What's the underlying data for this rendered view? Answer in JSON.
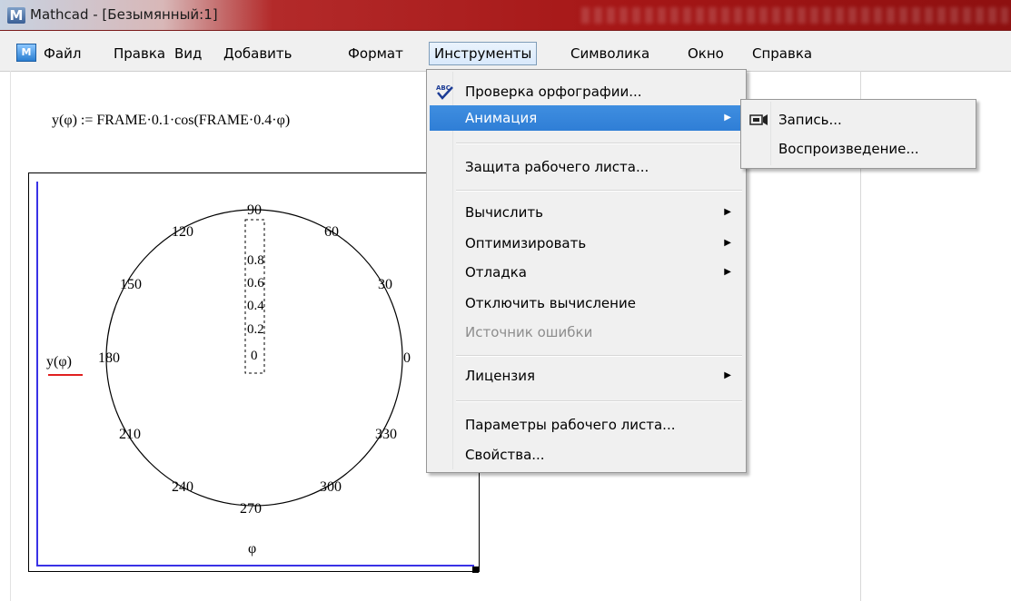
{
  "window": {
    "app_name": "Mathcad - [",
    "doc_name": "Безымянный:1",
    "title_close": "]"
  },
  "menubar": [
    {
      "label": "Файл"
    },
    {
      "label": "Правка"
    },
    {
      "label": "Вид"
    },
    {
      "label": "Добавить"
    },
    {
      "label": "Формат"
    },
    {
      "label": "Инструменты"
    },
    {
      "label": "Символика"
    },
    {
      "label": "Окно"
    },
    {
      "label": "Справка"
    }
  ],
  "worksheet": {
    "formula": "y(φ) := FRAME·0.1·cos(FRAME·0.4·φ)",
    "plot": {
      "ylabel": "y(φ)",
      "xlabel": "φ",
      "angle_labels": [
        "90",
        "60",
        "30",
        "0",
        "330",
        "300",
        "270",
        "240",
        "210",
        "180",
        "150",
        "120"
      ],
      "radial_labels": [
        "0.8",
        "0.6",
        "0.4",
        "0.2",
        "0"
      ]
    }
  },
  "tools_menu": {
    "items": [
      {
        "label": "Проверка орфографии...",
        "icon": "spellcheck-icon"
      },
      {
        "label": "Анимация",
        "submenu": true,
        "highlighted": true
      },
      {
        "label": "Защита рабочего листа..."
      },
      {
        "label": "Вычислить",
        "submenu": true
      },
      {
        "label": "Оптимизировать",
        "submenu": true
      },
      {
        "label": "Отладка",
        "submenu": true
      },
      {
        "label": "Отключить вычисление"
      },
      {
        "label": "Источник ошибки",
        "disabled": true
      },
      {
        "label": "Лицензия",
        "submenu": true
      },
      {
        "label": "Параметры рабочего листа..."
      },
      {
        "label": "Свойства..."
      }
    ]
  },
  "animation_submenu": {
    "items": [
      {
        "label": "Запись...",
        "icon": "record-icon"
      },
      {
        "label": "Воспроизведение..."
      }
    ]
  },
  "colors": {
    "highlight": "#3f8ee0",
    "axis": "#3a32e6",
    "title_bar": "#a51616"
  }
}
